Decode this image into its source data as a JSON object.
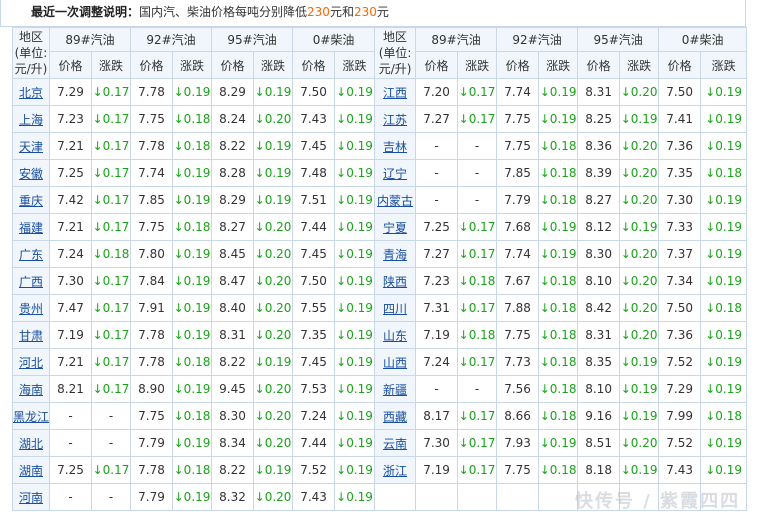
{
  "summary": {
    "lead": "最近一次调整说明：",
    "text": "国内汽、柴油价格每吨分别降低",
    "num1": "230",
    "unit1": "元和",
    "num2": "230",
    "unit2": "元"
  },
  "header": {
    "region_label": "地区(单位:元/升)",
    "fuels": [
      "89#汽油",
      "92#汽油",
      "95#汽油",
      "0#柴油"
    ],
    "price_label": "价格",
    "change_label": "涨跌"
  },
  "rows": [
    [
      {
        "name": "北京",
        "v": [
          "7.29",
          "↓0.17",
          "7.78",
          "↓0.19",
          "8.29",
          "↓0.19",
          "7.50",
          "↓0.19"
        ]
      },
      {
        "name": "江西",
        "v": [
          "7.20",
          "↓0.17",
          "7.74",
          "↓0.19",
          "8.31",
          "↓0.20",
          "7.50",
          "↓0.19"
        ]
      }
    ],
    [
      {
        "name": "上海",
        "v": [
          "7.23",
          "↓0.17",
          "7.75",
          "↓0.18",
          "8.24",
          "↓0.20",
          "7.43",
          "↓0.19"
        ]
      },
      {
        "name": "江苏",
        "v": [
          "7.27",
          "↓0.17",
          "7.75",
          "↓0.19",
          "8.25",
          "↓0.19",
          "7.41",
          "↓0.19"
        ]
      }
    ],
    [
      {
        "name": "天津",
        "v": [
          "7.21",
          "↓0.17",
          "7.78",
          "↓0.18",
          "8.22",
          "↓0.19",
          "7.45",
          "↓0.19"
        ]
      },
      {
        "name": "吉林",
        "v": [
          "-",
          "-",
          "7.75",
          "↓0.18",
          "8.36",
          "↓0.20",
          "7.36",
          "↓0.19"
        ]
      }
    ],
    [
      {
        "name": "安徽",
        "v": [
          "7.25",
          "↓0.17",
          "7.74",
          "↓0.19",
          "8.28",
          "↓0.19",
          "7.48",
          "↓0.19"
        ]
      },
      {
        "name": "辽宁",
        "v": [
          "-",
          "-",
          "7.85",
          "↓0.18",
          "8.39",
          "↓0.20",
          "7.35",
          "↓0.18"
        ]
      }
    ],
    [
      {
        "name": "重庆",
        "v": [
          "7.42",
          "↓0.17",
          "7.85",
          "↓0.19",
          "8.29",
          "↓0.19",
          "7.51",
          "↓0.19"
        ]
      },
      {
        "name": "内蒙古",
        "v": [
          "-",
          "-",
          "7.79",
          "↓0.18",
          "8.27",
          "↓0.20",
          "7.30",
          "↓0.19"
        ]
      }
    ],
    [
      {
        "name": "福建",
        "v": [
          "7.21",
          "↓0.17",
          "7.75",
          "↓0.18",
          "8.27",
          "↓0.20",
          "7.44",
          "↓0.19"
        ]
      },
      {
        "name": "宁夏",
        "v": [
          "7.25",
          "↓0.17",
          "7.68",
          "↓0.19",
          "8.12",
          "↓0.19",
          "7.33",
          "↓0.19"
        ]
      }
    ],
    [
      {
        "name": "广东",
        "v": [
          "7.24",
          "↓0.18",
          "7.80",
          "↓0.19",
          "8.45",
          "↓0.20",
          "7.45",
          "↓0.19"
        ]
      },
      {
        "name": "青海",
        "v": [
          "7.27",
          "↓0.17",
          "7.74",
          "↓0.19",
          "8.30",
          "↓0.20",
          "7.37",
          "↓0.19"
        ]
      }
    ],
    [
      {
        "name": "广西",
        "v": [
          "7.30",
          "↓0.17",
          "7.84",
          "↓0.19",
          "8.47",
          "↓0.20",
          "7.50",
          "↓0.19"
        ]
      },
      {
        "name": "陕西",
        "v": [
          "7.23",
          "↓0.18",
          "7.67",
          "↓0.18",
          "8.10",
          "↓0.20",
          "7.34",
          "↓0.19"
        ]
      }
    ],
    [
      {
        "name": "贵州",
        "v": [
          "7.47",
          "↓0.17",
          "7.91",
          "↓0.19",
          "8.40",
          "↓0.20",
          "7.55",
          "↓0.19"
        ]
      },
      {
        "name": "四川",
        "v": [
          "7.31",
          "↓0.17",
          "7.88",
          "↓0.18",
          "8.42",
          "↓0.20",
          "7.50",
          "↓0.18"
        ]
      }
    ],
    [
      {
        "name": "甘肃",
        "v": [
          "7.19",
          "↓0.17",
          "7.78",
          "↓0.19",
          "8.31",
          "↓0.20",
          "7.35",
          "↓0.19"
        ]
      },
      {
        "name": "山东",
        "v": [
          "7.19",
          "↓0.18",
          "7.75",
          "↓0.18",
          "8.31",
          "↓0.20",
          "7.36",
          "↓0.19"
        ]
      }
    ],
    [
      {
        "name": "河北",
        "v": [
          "7.21",
          "↓0.17",
          "7.78",
          "↓0.18",
          "8.22",
          "↓0.19",
          "7.45",
          "↓0.19"
        ]
      },
      {
        "name": "山西",
        "v": [
          "7.24",
          "↓0.17",
          "7.73",
          "↓0.18",
          "8.35",
          "↓0.19",
          "7.52",
          "↓0.19"
        ]
      }
    ],
    [
      {
        "name": "海南",
        "v": [
          "8.21",
          "↓0.17",
          "8.90",
          "↓0.19",
          "9.45",
          "↓0.20",
          "7.53",
          "↓0.19"
        ]
      },
      {
        "name": "新疆",
        "v": [
          "-",
          "-",
          "7.56",
          "↓0.18",
          "8.10",
          "↓0.19",
          "7.29",
          "↓0.19"
        ]
      }
    ],
    [
      {
        "name": "黑龙江",
        "v": [
          "-",
          "-",
          "7.75",
          "↓0.18",
          "8.30",
          "↓0.20",
          "7.24",
          "↓0.19"
        ]
      },
      {
        "name": "西藏",
        "v": [
          "8.17",
          "↓0.17",
          "8.66",
          "↓0.18",
          "9.16",
          "↓0.19",
          "7.99",
          "↓0.18"
        ]
      }
    ],
    [
      {
        "name": "湖北",
        "v": [
          "-",
          "-",
          "7.79",
          "↓0.19",
          "8.34",
          "↓0.20",
          "7.44",
          "↓0.19"
        ]
      },
      {
        "name": "云南",
        "v": [
          "7.30",
          "↓0.17",
          "7.93",
          "↓0.19",
          "8.51",
          "↓0.20",
          "7.52",
          "↓0.19"
        ]
      }
    ],
    [
      {
        "name": "湖南",
        "v": [
          "7.25",
          "↓0.17",
          "7.78",
          "↓0.18",
          "8.22",
          "↓0.19",
          "7.52",
          "↓0.19"
        ]
      },
      {
        "name": "浙江",
        "v": [
          "7.19",
          "↓0.17",
          "7.75",
          "↓0.18",
          "8.18",
          "↓0.19",
          "7.43",
          "↓0.19"
        ]
      }
    ],
    [
      {
        "name": "河南",
        "v": [
          "-",
          "-",
          "7.79",
          "↓0.19",
          "8.32",
          "↓0.20",
          "7.43",
          "↓0.19"
        ]
      },
      null
    ]
  ],
  "watermark": "快传号 / 紫霞四四",
  "colors": {
    "change_down": "#1aa31a",
    "region_link": "#1a4fa0",
    "header_bg": "#f0f6fb",
    "border": "#c8d8e8",
    "highlight": "#ff6600"
  }
}
